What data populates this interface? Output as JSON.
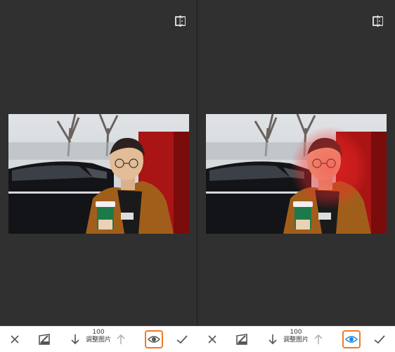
{
  "panels": [
    {
      "id": "left",
      "toolbar": {
        "close_icon": "close-icon",
        "brush_icon": "brush-icon",
        "decrease_icon": "arrow-down-icon",
        "value": "100",
        "label": "调整图片",
        "increase_icon": "arrow-up-icon",
        "eye_icon": "eye-icon",
        "eye_active": false,
        "apply_icon": "check-icon"
      }
    },
    {
      "id": "right",
      "toolbar": {
        "close_icon": "close-icon",
        "brush_icon": "brush-icon",
        "decrease_icon": "arrow-down-icon",
        "value": "100",
        "label": "调整图片",
        "increase_icon": "arrow-up-icon",
        "eye_icon": "eye-icon",
        "eye_active": true,
        "apply_icon": "check-icon"
      }
    }
  ],
  "colors": {
    "canvas_bg": "#303030",
    "highlight_border": "#f07a22",
    "eye_active": "#1e88e5",
    "icon_default": "#555555",
    "mask_overlay": "#ff2a2a"
  }
}
